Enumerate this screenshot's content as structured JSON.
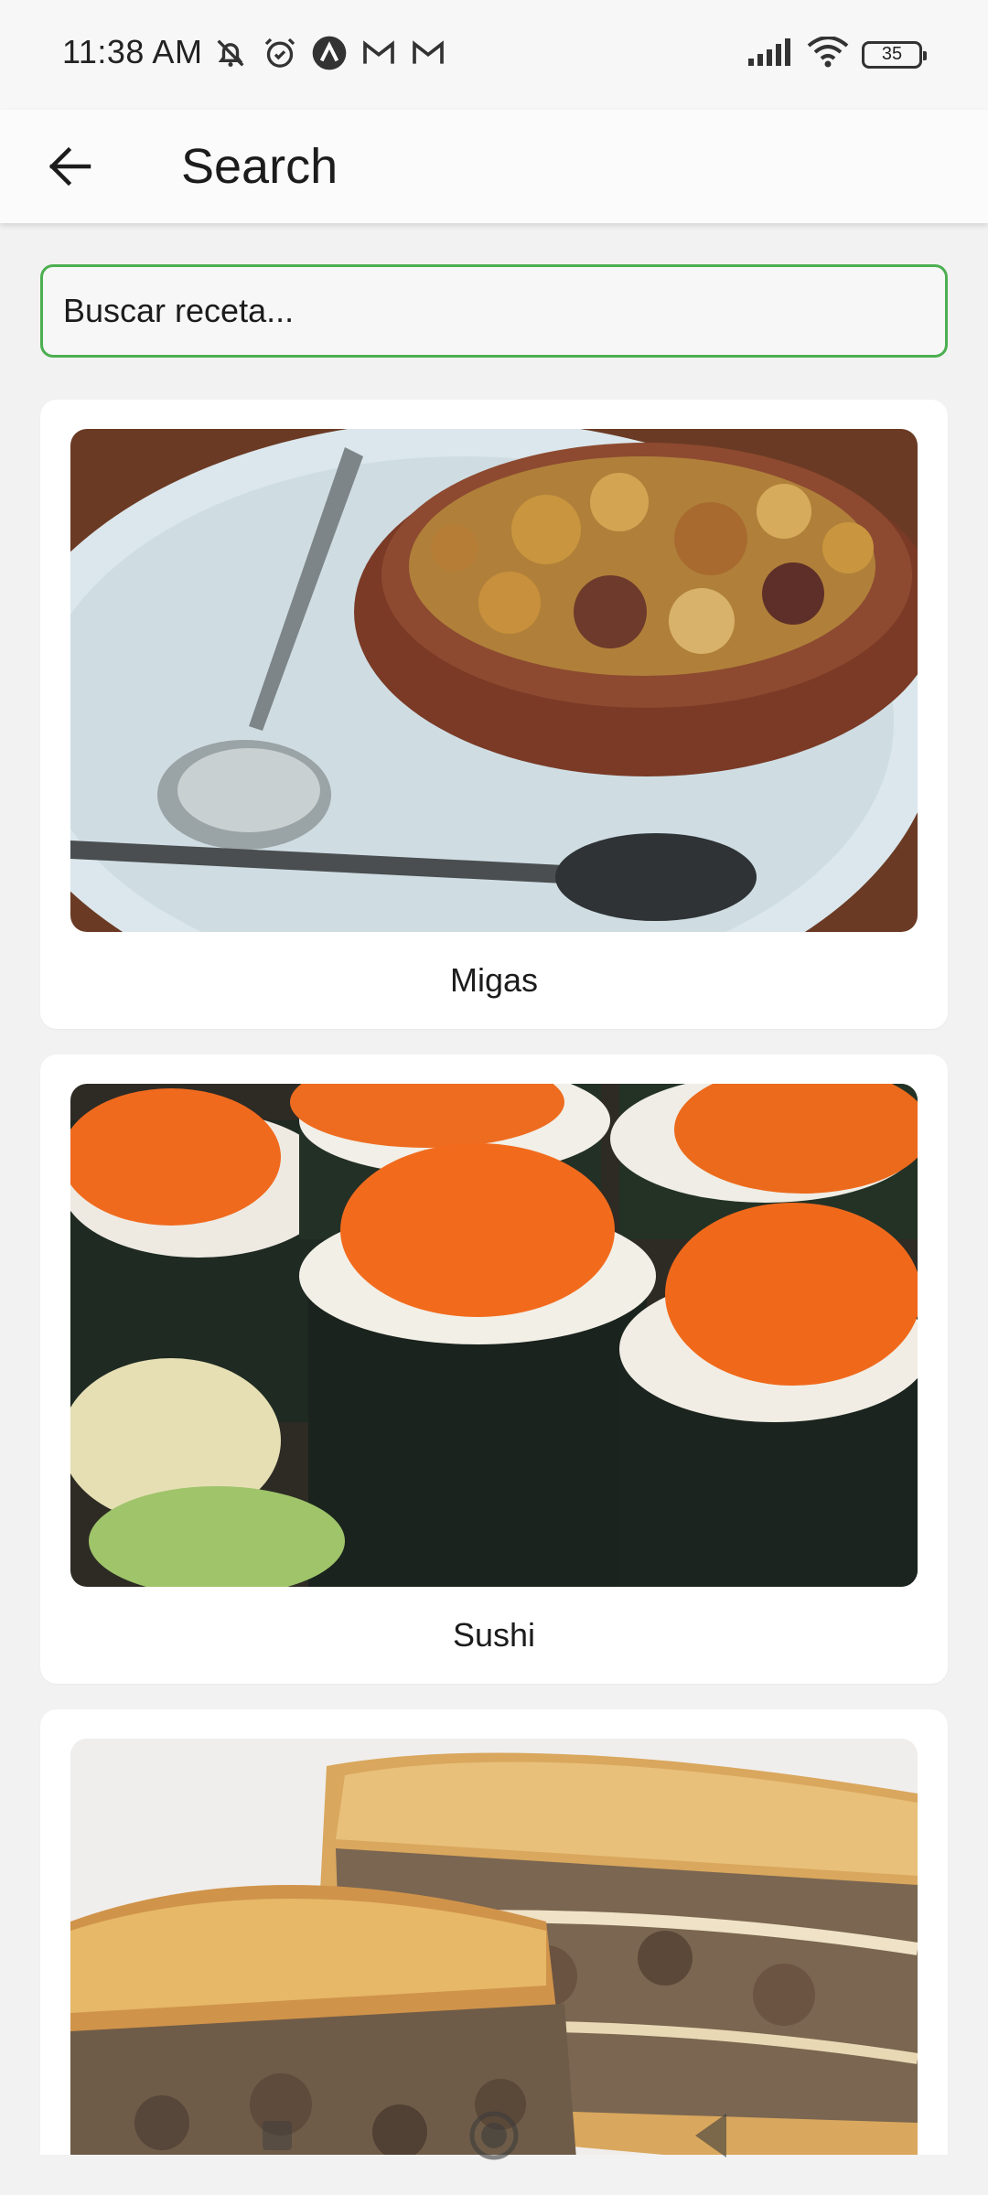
{
  "status_bar": {
    "time": "11:38 AM",
    "battery_level": "35",
    "icons": [
      "mute-off-icon",
      "alarm-icon",
      "app-a-icon",
      "gmail-icon",
      "gmail-icon",
      "signal-icon",
      "wifi-icon",
      "battery-icon"
    ]
  },
  "app_bar": {
    "title": "Search",
    "back_icon": "arrow-left-icon"
  },
  "search": {
    "placeholder": "Buscar receta...",
    "value": "",
    "border_color": "#4caf50"
  },
  "recipes": [
    {
      "title": "Migas"
    },
    {
      "title": "Sushi"
    },
    {
      "title": ""
    }
  ],
  "nav_bar": {
    "icons": [
      "recents-icon",
      "home-icon",
      "back-icon"
    ]
  }
}
